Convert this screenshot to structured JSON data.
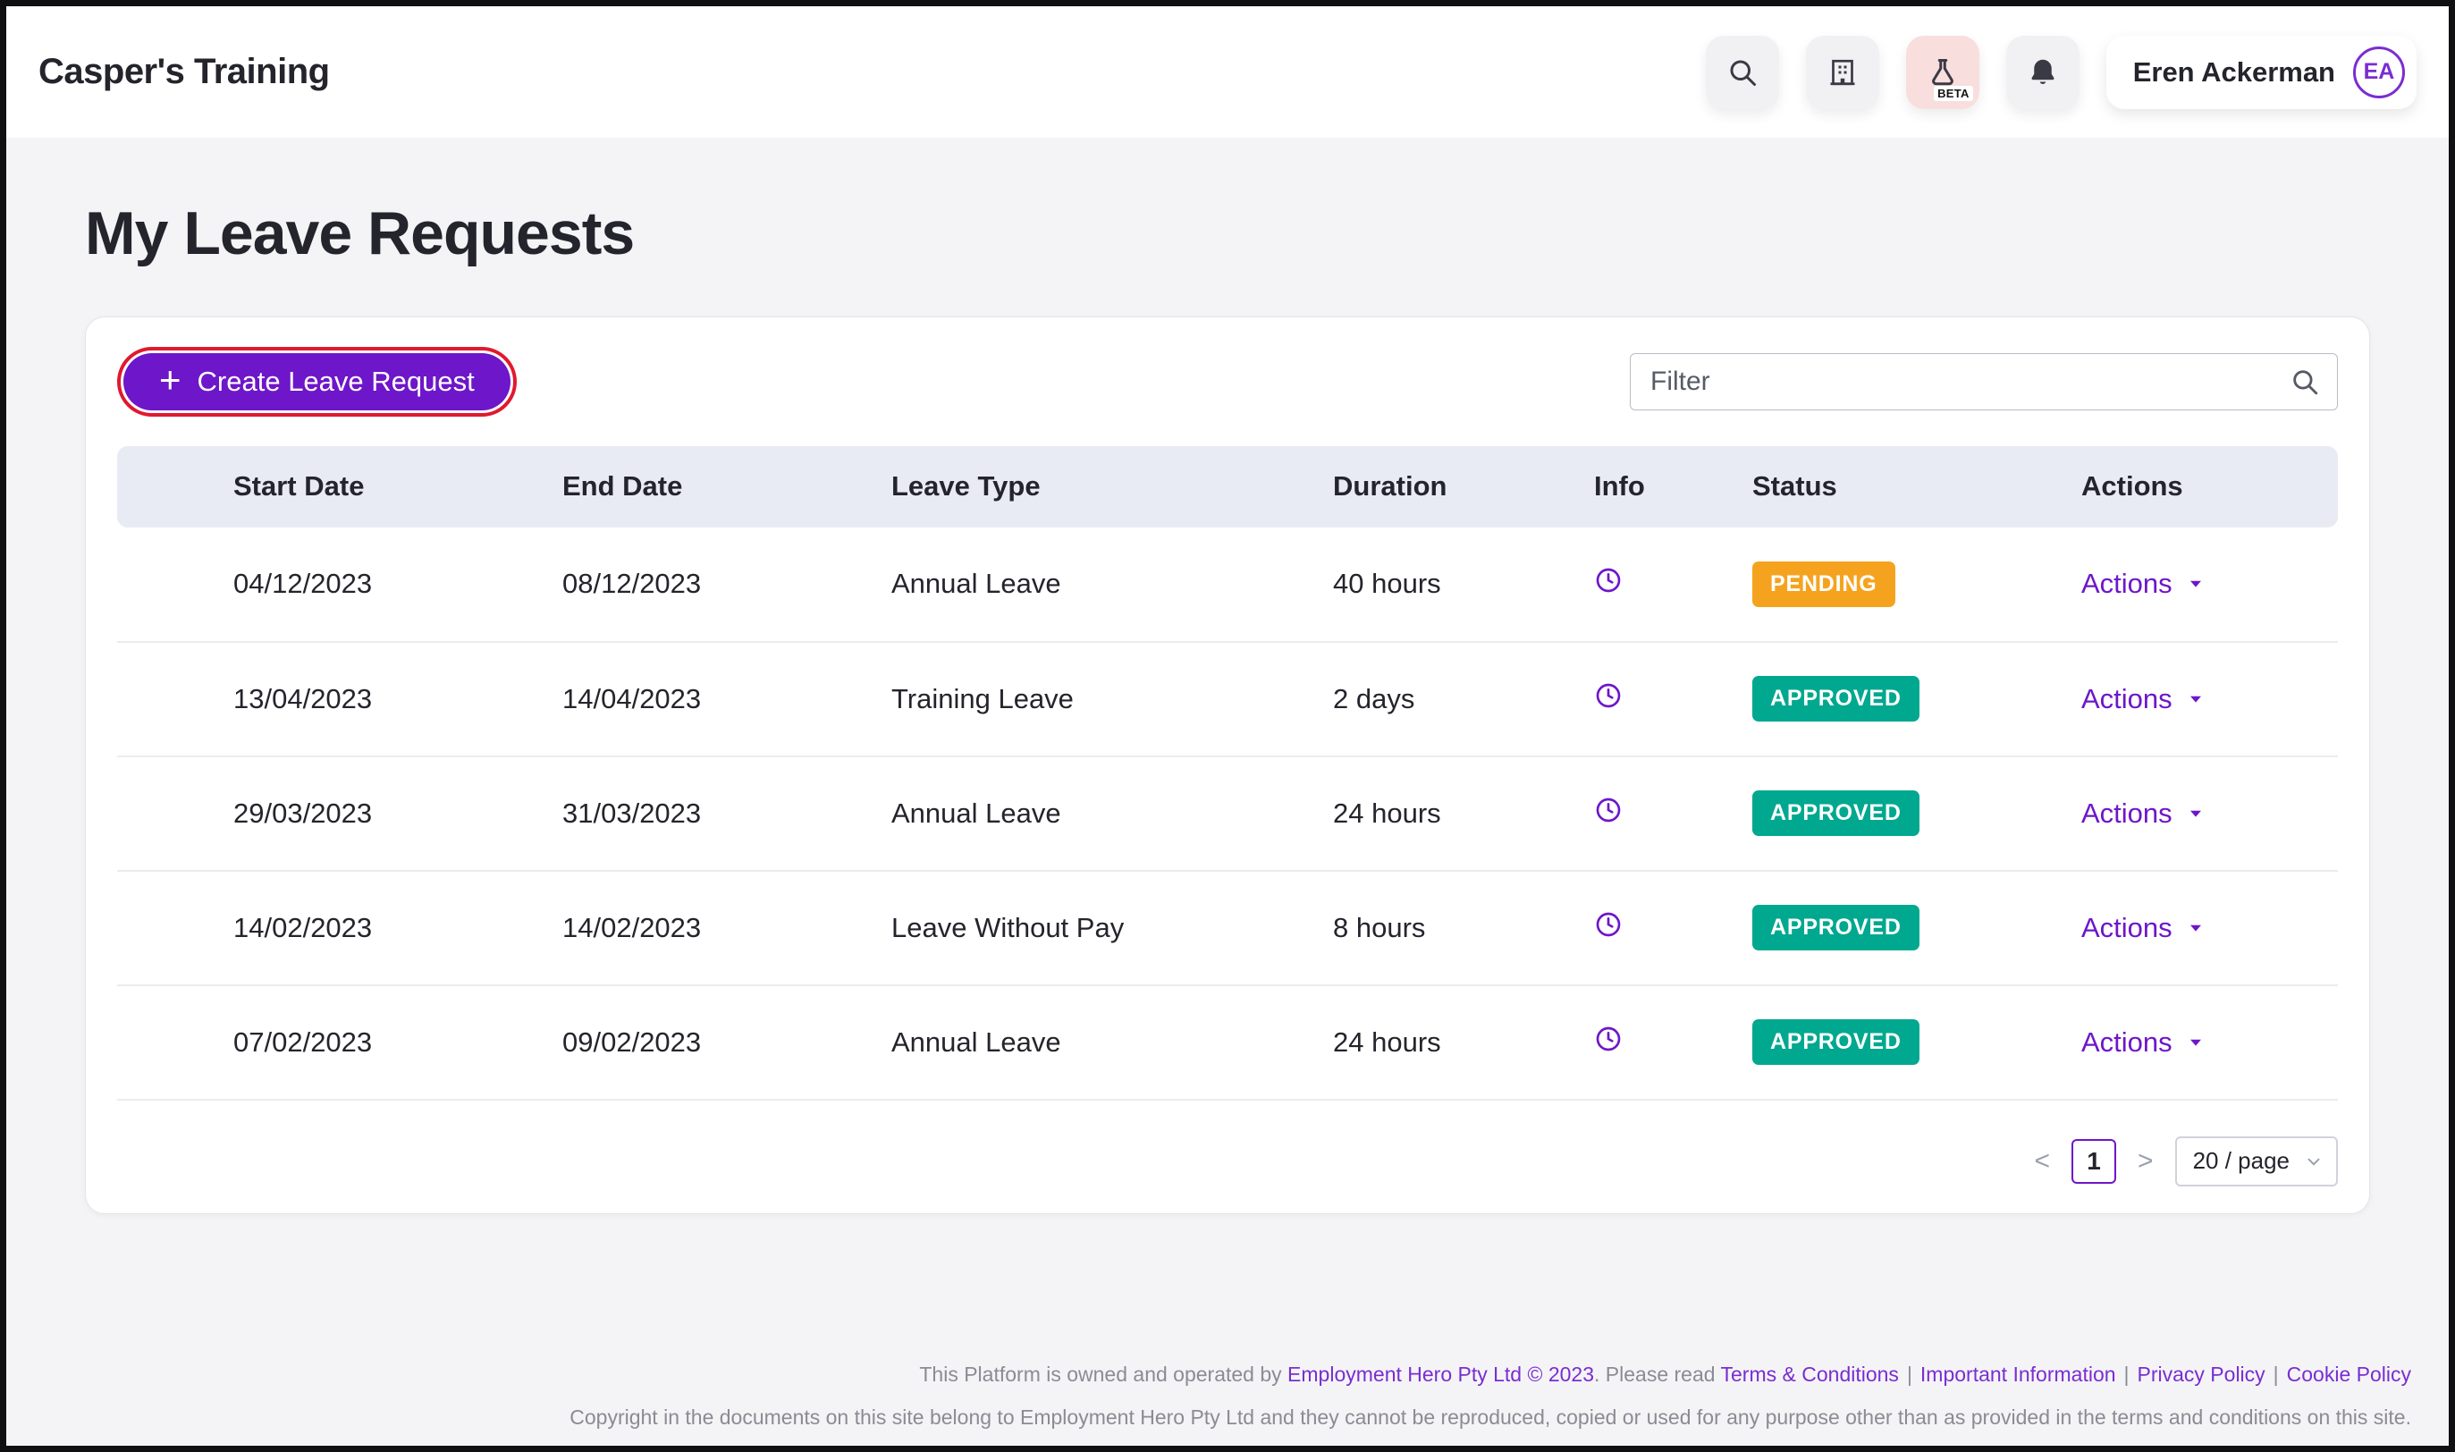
{
  "colors": {
    "accent_purple": "#6E16C9",
    "link_purple": "#7A2DD2",
    "pending_orange": "#F5A31F",
    "approved_teal": "#00A88F",
    "highlight_red": "#E0192E",
    "table_header_bg": "#E8EBF3",
    "page_bg": "#F4F4F6"
  },
  "header": {
    "app_title": "Casper's Training",
    "beta_label": "BETA",
    "user": {
      "name": "Eren Ackerman",
      "initials": "EA"
    }
  },
  "page": {
    "title": "My Leave Requests"
  },
  "toolbar": {
    "create_button": "Create Leave Request",
    "filter_placeholder": "Filter"
  },
  "table": {
    "columns": [
      "Start Date",
      "End Date",
      "Leave Type",
      "Duration",
      "Info",
      "Status",
      "Actions"
    ],
    "rows": [
      {
        "start_date": "04/12/2023",
        "end_date": "08/12/2023",
        "leave_type": "Annual Leave",
        "duration": "40 hours",
        "status": "PENDING",
        "actions": "Actions"
      },
      {
        "start_date": "13/04/2023",
        "end_date": "14/04/2023",
        "leave_type": "Training Leave",
        "duration": "2 days",
        "status": "APPROVED",
        "actions": "Actions"
      },
      {
        "start_date": "29/03/2023",
        "end_date": "31/03/2023",
        "leave_type": "Annual Leave",
        "duration": "24 hours",
        "status": "APPROVED",
        "actions": "Actions"
      },
      {
        "start_date": "14/02/2023",
        "end_date": "14/02/2023",
        "leave_type": "Leave Without Pay",
        "duration": "8 hours",
        "status": "APPROVED",
        "actions": "Actions"
      },
      {
        "start_date": "07/02/2023",
        "end_date": "09/02/2023",
        "leave_type": "Annual Leave",
        "duration": "24 hours",
        "status": "APPROVED",
        "actions": "Actions"
      }
    ]
  },
  "pagination": {
    "prev": "<",
    "current_page": "1",
    "next": ">",
    "page_size": "20 / page"
  },
  "footer": {
    "text1": "This Platform is owned and operated by ",
    "owner_link": "Employment Hero Pty Ltd © 2023",
    "text2": ". Please read ",
    "terms_link": "Terms & Conditions",
    "separator": "|",
    "info_link": "Important Information",
    "privacy_link": "Privacy Policy",
    "cookie_link": "Cookie Policy",
    "line2": "Copyright in the documents on this site belong to Employment Hero Pty Ltd and they cannot be reproduced, copied or used for any purpose other than as provided in the terms and conditions on this site."
  }
}
